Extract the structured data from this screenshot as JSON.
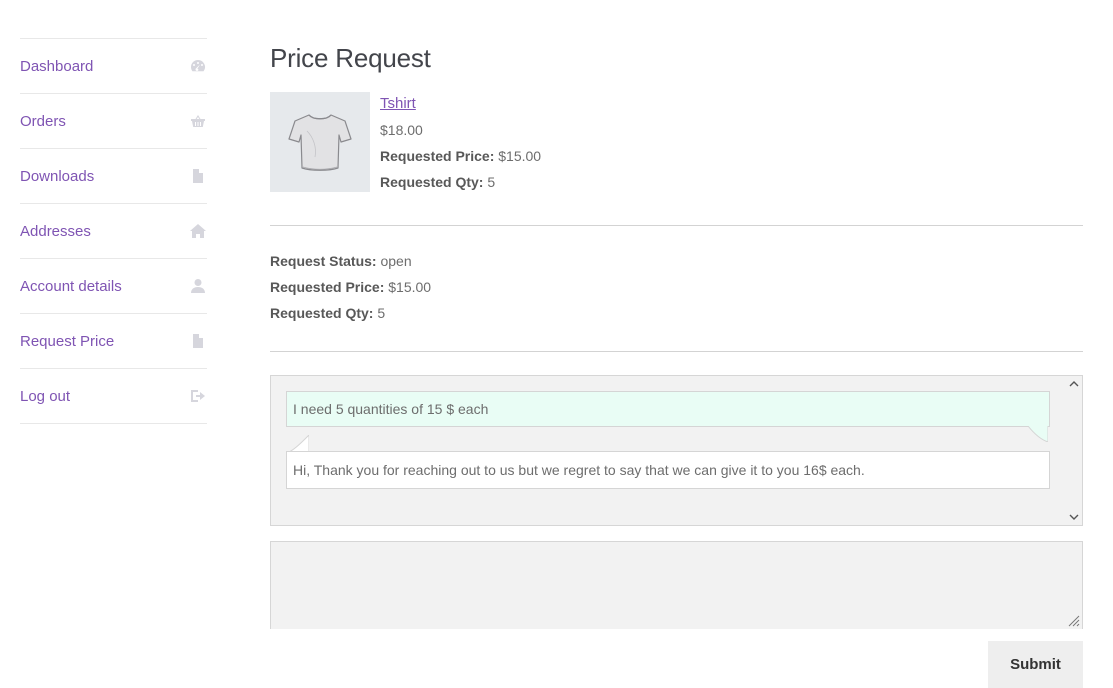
{
  "nav": {
    "items": [
      {
        "label": "Dashboard",
        "icon": "dashboard-icon"
      },
      {
        "label": "Orders",
        "icon": "basket-icon"
      },
      {
        "label": "Downloads",
        "icon": "file-download-icon"
      },
      {
        "label": "Addresses",
        "icon": "home-icon"
      },
      {
        "label": "Account details",
        "icon": "user-icon"
      },
      {
        "label": "Request Price",
        "icon": "document-icon"
      },
      {
        "label": "Log out",
        "icon": "logout-icon"
      }
    ]
  },
  "page": {
    "title": "Price Request"
  },
  "product": {
    "name": "Tshirt",
    "price": "$18.00",
    "requested_price_label": "Requested Price:",
    "requested_price": "$15.00",
    "requested_qty_label": "Requested Qty:",
    "requested_qty": "5"
  },
  "request": {
    "status_label": "Request Status:",
    "status": "open",
    "price_label": "Requested Price:",
    "price": "$15.00",
    "qty_label": "Requested Qty:",
    "qty": "5"
  },
  "conversation": {
    "messages": [
      {
        "text": "I need 5 quantities of 15 $ each"
      },
      {
        "text": "Hi, Thank you for reaching out to us but we regret to say that we can give it to you 16$ each."
      }
    ]
  },
  "reply": {
    "value": "",
    "submit_label": "Submit"
  },
  "colors": {
    "link": "#7f54b3",
    "icon": "#d6d6dd",
    "customer_bubble": "#e9fdf5"
  }
}
